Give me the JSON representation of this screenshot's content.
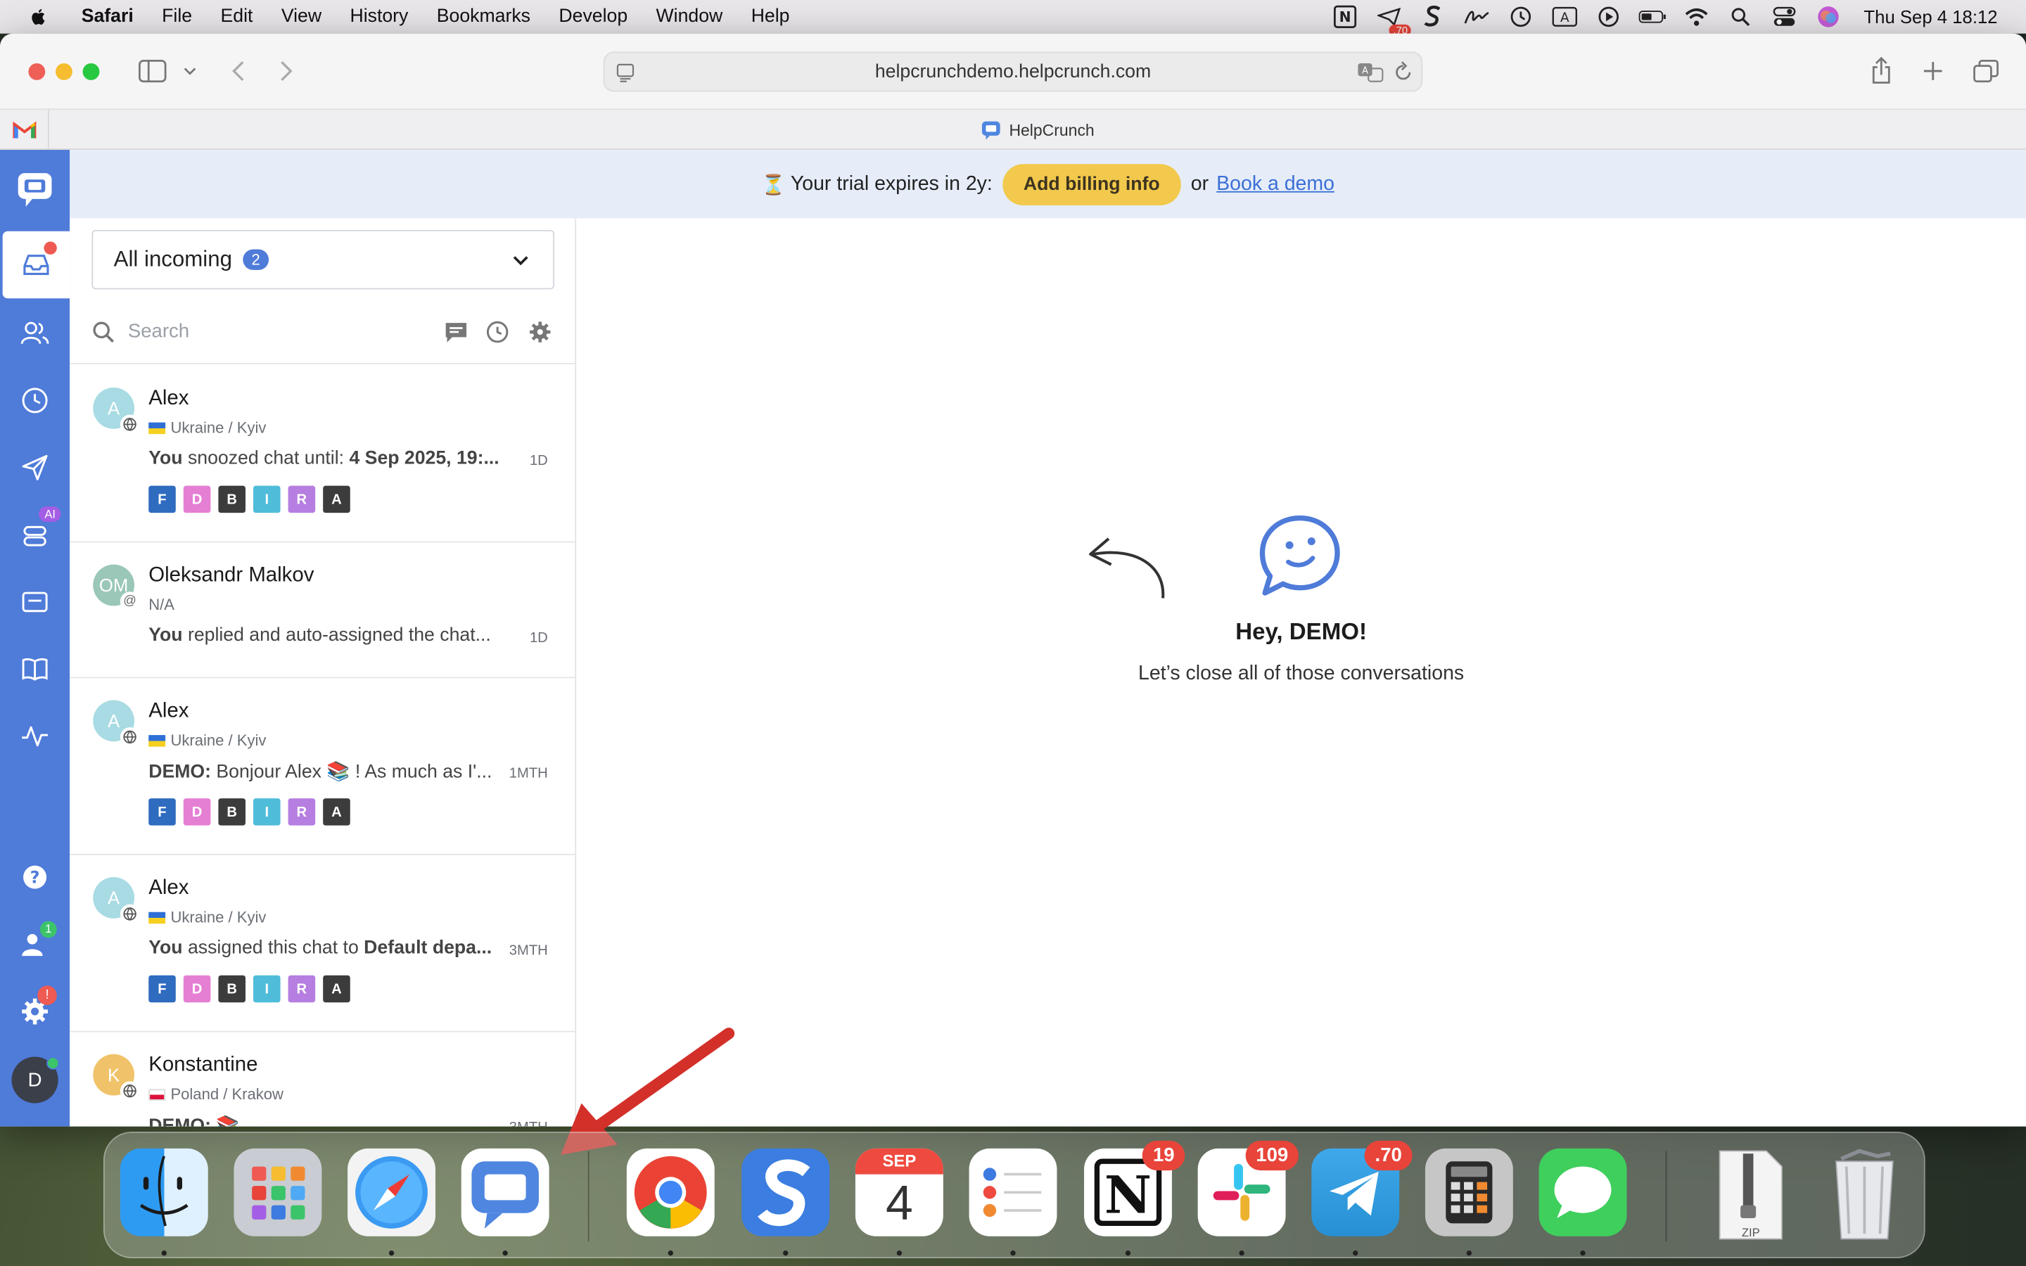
{
  "menubar": {
    "app": "Safari",
    "items": [
      "File",
      "Edit",
      "View",
      "History",
      "Bookmarks",
      "Develop",
      "Window",
      "Help"
    ],
    "clock": "Thu Sep 4  18:12",
    "status_badge": ".70"
  },
  "browser": {
    "url": "helpcrunchdemo.helpcrunch.com",
    "tab_title": "HelpCrunch"
  },
  "banner": {
    "text": "Your trial expires in 2y:",
    "billing_button": "Add billing info",
    "or": "or",
    "demo_link": "Book a demo"
  },
  "list": {
    "filter_label": "All incoming",
    "filter_count": "2",
    "search_placeholder": "Search",
    "conversations": [
      {
        "initials": "A",
        "name": "Alex",
        "location": "Ukraine / Kyiv",
        "sender": "You",
        "message": " snoozed chat until: ",
        "message_bold": "4 Sep 2025, 19:...",
        "time": "1D",
        "tags": [
          "F",
          "D",
          "B",
          "I",
          "R",
          "A"
        ]
      },
      {
        "initials": "OM",
        "name": "Oleksandr Malkov",
        "location": "N/A",
        "sender": "You",
        "message": " replied and auto-assigned the chat...",
        "message_bold": "",
        "time": "1D",
        "tags": []
      },
      {
        "initials": "A",
        "name": "Alex",
        "location": "Ukraine / Kyiv",
        "sender": "DEMO:",
        "message": " Bonjour Alex 📚 ! As much as I'...",
        "message_bold": "",
        "time": "1MTH",
        "tags": [
          "F",
          "D",
          "B",
          "I",
          "R",
          "A"
        ]
      },
      {
        "initials": "A",
        "name": "Alex",
        "location": "Ukraine / Kyiv",
        "sender": "You",
        "message": " assigned this chat to ",
        "message_bold": "Default depa...",
        "time": "3MTH",
        "tags": [
          "F",
          "D",
          "B",
          "I",
          "R",
          "A"
        ]
      },
      {
        "initials": "K",
        "name": "Konstantine",
        "location": "Poland / Krakow",
        "sender": "DEMO:",
        "message": " 📚",
        "message_bold": "",
        "time": "3MTH",
        "tags": []
      }
    ]
  },
  "main": {
    "greeting": "Hey, DEMO!",
    "subtitle": "Let’s close all of those conversations"
  },
  "rail": {
    "ai_badge": "AI",
    "team_badge": "1",
    "settings_badge": "!",
    "user_initial": "D"
  },
  "dock": {
    "calendar_month": "SEP",
    "calendar_day": "4",
    "notion_badge": "19",
    "slack_badge": "109",
    "telegram_badge": ".70",
    "zip_label": "ZIP"
  },
  "colors": {
    "rail": "#4f7bd9",
    "billing": "#f2c94c",
    "banner": "#e6edf9"
  }
}
